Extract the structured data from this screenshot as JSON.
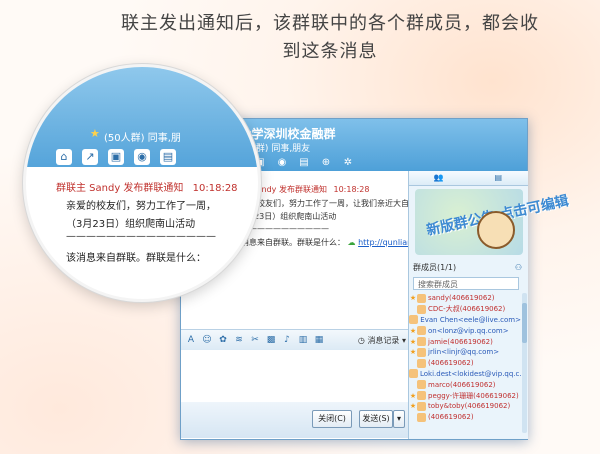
{
  "caption": {
    "line1": "联主发出通知后，该群联中的各个群成员，都会收",
    "line2": "到这条消息"
  },
  "window": {
    "group_title": "XX大学深圳校金融群",
    "group_count": "(50人群)",
    "group_sub": "同事,朋友",
    "toolbar_icons": [
      "home-icon",
      "share-icon",
      "folder-icon",
      "video-icon",
      "clipboard-icon",
      "apps-icon",
      "gear-icon"
    ]
  },
  "chat": {
    "sender": "群联主 Sandy 发布群联通知",
    "time": "10:18:28",
    "line1": "亲爱的校友们，努力工作了一周，让我们亲近大自然！",
    "line2": "（3月23日）组织爬南山活动",
    "line3": "————————————",
    "line4": "该消息来自群联。群联是什么：",
    "link": "http://qunlian.qq.com/"
  },
  "format_bar": {
    "history": "消息记录"
  },
  "buttons": {
    "close": "关闭(C)",
    "send": "发送(S)"
  },
  "right_panel": {
    "ad_text": "新版群公告 点击可编辑",
    "members_label": "群成员(1/1)",
    "search_placeholder": "搜索群成员",
    "members": [
      {
        "star": true,
        "name": "sandy(406619062)",
        "color": "#c03030"
      },
      {
        "star": false,
        "name": "CDC-大叔(406619062)",
        "color": "#c03030"
      },
      {
        "star": false,
        "name": "Evan Chen<eele@live.com>",
        "color": "#2a5ab8"
      },
      {
        "star": true,
        "name": "on<lonz@vip.qq.com>",
        "color": "#2a5ab8"
      },
      {
        "star": true,
        "name": "jamie(406619062)",
        "color": "#c03030"
      },
      {
        "star": true,
        "name": "jrlin<linjr@qq.com>",
        "color": "#2a5ab8"
      },
      {
        "star": false,
        "name": "(406619062)",
        "color": "#c03030"
      },
      {
        "star": false,
        "name": "Loki.dest<lokidest@vip.qq.c...",
        "color": "#2a5ab8"
      },
      {
        "star": false,
        "name": "marco(406619062)",
        "color": "#c03030"
      },
      {
        "star": true,
        "name": "peggy-许珊珊(406619062)",
        "color": "#c03030"
      },
      {
        "star": true,
        "name": "toby&toby(406619062)",
        "color": "#c03030"
      },
      {
        "star": false,
        "name": "(406619062)",
        "color": "#c03030"
      }
    ]
  },
  "magnifier": {
    "group_count": "(50人群)",
    "group_sub": "同事,朋",
    "sender": "群联主 Sandy 发布群联通知",
    "time": "10:18:28",
    "line1": "亲爱的校友们，努力工作了一周，",
    "line2": "（3月23日）组织爬南山活动",
    "line3": "———————————————",
    "line4": "该消息来自群联。群联是什么："
  }
}
